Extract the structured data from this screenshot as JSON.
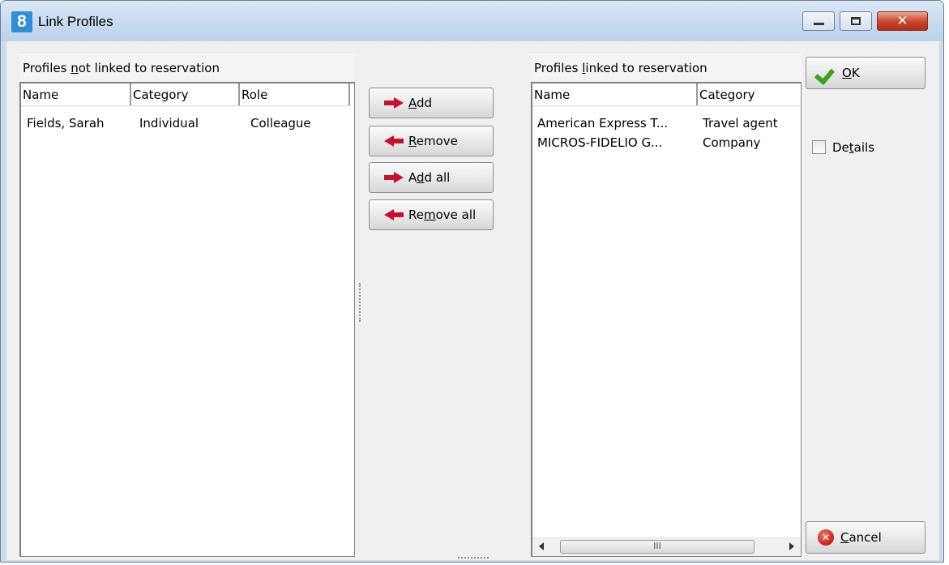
{
  "window": {
    "icon_text": "8",
    "title": "Link Profiles",
    "icon": "app-logo-icon",
    "controls": [
      "minimize-icon",
      "maximize-icon",
      "close-icon"
    ],
    "close_glyph": "✕"
  },
  "left_panel": {
    "header_pre": "Profiles ",
    "header_accel": "n",
    "header_post": "ot linked to reservation",
    "columns": [
      "Name",
      "Category",
      "Role"
    ],
    "rows": [
      {
        "name": "Fields, Sarah",
        "category": "Individual",
        "role": "Colleague"
      }
    ]
  },
  "buttons": {
    "add_accel": "A",
    "add_rest": "dd",
    "remove_accel": "R",
    "remove_rest": "emove",
    "addall_pre": "A",
    "addall_accel": "d",
    "addall_rest": "d all",
    "removeall_pre": "Re",
    "removeall_accel": "m",
    "removeall_rest": "ove all"
  },
  "right_panel": {
    "header_pre": "Profiles ",
    "header_accel": "l",
    "header_post": "inked to reservation",
    "columns": [
      "Name",
      "Category"
    ],
    "rows": [
      {
        "name": "American Express T...",
        "category": "Travel agent"
      },
      {
        "name": "MICROS-FIDELIO G...",
        "category": "Company"
      }
    ],
    "scroll_thumb_glyph": "III"
  },
  "actions": {
    "ok_accel": "O",
    "ok_rest": "K",
    "details_pre": "De",
    "details_accel": "t",
    "details_rest": "ails",
    "details_checked": false,
    "cancel_accel": "C",
    "cancel_rest": "ancel"
  },
  "colors": {
    "arrow": "#c8102e",
    "ok_check": "#3fa21b",
    "cancel": "#c41e12",
    "title_bar": "#c5d9ee",
    "close_button": "#c8442a"
  }
}
